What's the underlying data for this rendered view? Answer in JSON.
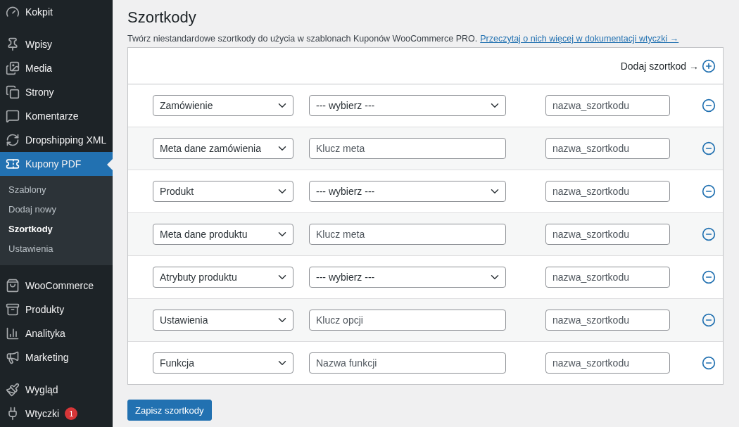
{
  "sidebar": {
    "groups": [
      [
        {
          "label": "Kokpit",
          "selected": false
        }
      ],
      [
        {
          "label": "Wpisy",
          "selected": false
        },
        {
          "label": "Media",
          "selected": false
        },
        {
          "label": "Strony",
          "selected": false
        },
        {
          "label": "Komentarze",
          "selected": false
        },
        {
          "label": "Dropshipping XML",
          "selected": false
        },
        {
          "label": "Kupony PDF",
          "selected": true,
          "submenu": [
            {
              "label": "Szablony",
              "selected": false
            },
            {
              "label": "Dodaj nowy",
              "selected": false
            },
            {
              "label": "Szortkody",
              "selected": true
            },
            {
              "label": "Ustawienia",
              "selected": false
            }
          ]
        }
      ],
      [
        {
          "label": "WooCommerce",
          "selected": false
        },
        {
          "label": "Produkty",
          "selected": false
        },
        {
          "label": "Analityka",
          "selected": false
        },
        {
          "label": "Marketing",
          "selected": false
        }
      ],
      [
        {
          "label": "Wygląd",
          "selected": false
        },
        {
          "label": "Wtyczki",
          "selected": false,
          "badge": "1"
        }
      ]
    ]
  },
  "page": {
    "title": "Szortkody",
    "description": "Twórz niestandardowe szortkody do użycia w szablonach Kuponów WooCommerce PRO.",
    "doc_link": "Przeczytaj o nich więcej w dokumentacji wtyczki →"
  },
  "add_button": "Dodaj szortkod →",
  "rows": [
    {
      "type": "Zamówienie",
      "kind": "select",
      "value": "--- wybierz ---",
      "name_placeholder": "nazwa_szortkodu"
    },
    {
      "type": "Meta dane zamówienia",
      "kind": "input",
      "placeholder": "Klucz meta",
      "name_placeholder": "nazwa_szortkodu"
    },
    {
      "type": "Produkt",
      "kind": "select",
      "value": "--- wybierz ---",
      "name_placeholder": "nazwa_szortkodu"
    },
    {
      "type": "Meta dane produktu",
      "kind": "input",
      "placeholder": "Klucz meta",
      "name_placeholder": "nazwa_szortkodu"
    },
    {
      "type": "Atrybuty produktu",
      "kind": "select",
      "value": "--- wybierz ---",
      "name_placeholder": "nazwa_szortkodu"
    },
    {
      "type": "Ustawienia",
      "kind": "input",
      "placeholder": "Klucz opcji",
      "name_placeholder": "nazwa_szortkodu"
    },
    {
      "type": "Funkcja",
      "kind": "input",
      "placeholder": "Nazwa funkcji",
      "name_placeholder": "nazwa_szortkodu"
    }
  ],
  "save_button": "Zapisz szortkody"
}
